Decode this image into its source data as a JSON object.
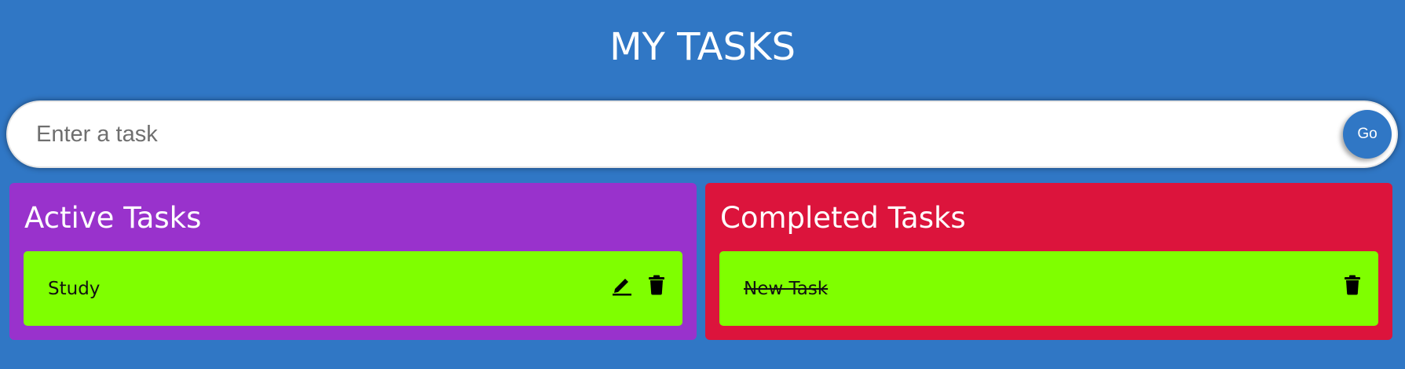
{
  "header": {
    "title": "MY TASKS"
  },
  "input": {
    "placeholder": "Enter a task",
    "value": "",
    "go_label": "Go"
  },
  "active_panel": {
    "title": "Active Tasks",
    "items": [
      {
        "label": "Study",
        "icons": [
          "pencil-edit-icon",
          "trash-icon"
        ]
      }
    ]
  },
  "completed_panel": {
    "title": "Completed Tasks",
    "items": [
      {
        "label": "New Task",
        "icons": [
          "trash-icon"
        ]
      }
    ]
  },
  "colors": {
    "background": "#3077c5",
    "active_panel": "#9932cc",
    "completed_panel": "#dc143c",
    "task_item": "#7fff00",
    "go_button": "#3077c5"
  }
}
